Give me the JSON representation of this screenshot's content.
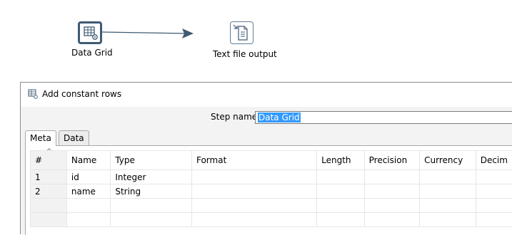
{
  "canvas": {
    "step1": {
      "label": "Data Grid",
      "icon": "data-grid-icon",
      "selected": true
    },
    "step2": {
      "label": "Text file output",
      "icon": "text-file-output-icon",
      "selected": false
    },
    "hop": {
      "color": "#3f5a73"
    }
  },
  "dialog": {
    "title": "Add constant rows",
    "step_name_label": "Step name",
    "step_name_value": "Data Grid",
    "tabs": [
      {
        "label": "Meta",
        "active": true
      },
      {
        "label": "Data",
        "active": false
      }
    ],
    "grid": {
      "columns": [
        "#",
        "Name",
        "Type",
        "Format",
        "Length",
        "Precision",
        "Currency",
        "Decim"
      ],
      "rows": [
        [
          "1",
          "id",
          "Integer",
          "",
          "",
          "",
          "",
          ""
        ],
        [
          "2",
          "name",
          "String",
          "",
          "",
          "",
          "",
          ""
        ],
        [
          "",
          "",
          "",
          "",
          "",
          "",
          "",
          ""
        ],
        [
          "",
          "",
          "",
          "",
          "",
          "",
          "",
          ""
        ]
      ]
    }
  },
  "colors": {
    "accent_selection": "#3399ff",
    "node_border": "#3f5a73"
  }
}
